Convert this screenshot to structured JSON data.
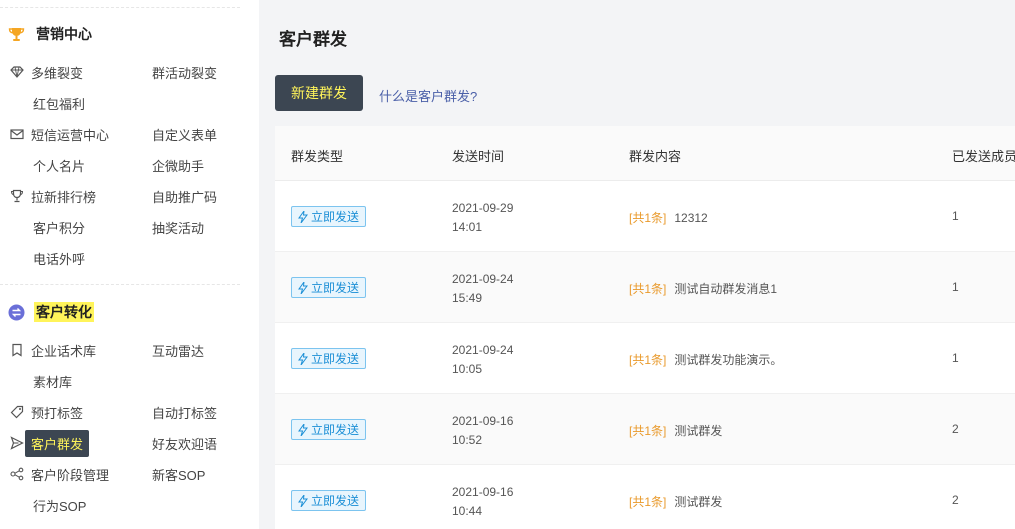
{
  "sidebar": {
    "marketing": {
      "title": "营销中心",
      "items": [
        {
          "label": "多维裂变",
          "icon": "diamond-icon"
        },
        {
          "label": "群活动裂变"
        },
        {
          "label": "红包福利"
        },
        {
          "label": "短信运营中心",
          "icon": "mail-icon"
        },
        {
          "label": "自定义表单"
        },
        {
          "label": "个人名片"
        },
        {
          "label": "企微助手"
        },
        {
          "label": "拉新排行榜",
          "icon": "trophy-icon"
        },
        {
          "label": "自助推广码"
        },
        {
          "label": "客户积分"
        },
        {
          "label": "抽奖活动"
        },
        {
          "label": "电话外呼"
        }
      ]
    },
    "conversion": {
      "title": "客户转化",
      "items": [
        {
          "label": "企业话术库",
          "icon": "bookmark-icon"
        },
        {
          "label": "互动雷达"
        },
        {
          "label": "素材库"
        },
        {
          "label": "预打标签",
          "icon": "tag-icon"
        },
        {
          "label": "自动打标签"
        },
        {
          "label": "客户群发",
          "icon": "send-icon",
          "active": true
        },
        {
          "label": "好友欢迎语"
        },
        {
          "label": "客户阶段管理",
          "icon": "flow-icon"
        },
        {
          "label": "新客SOP"
        },
        {
          "label": "行为SOP"
        }
      ]
    }
  },
  "main": {
    "title": "客户群发",
    "new_button": "新建群发",
    "help_link": "什么是客户群发?",
    "table": {
      "columns": [
        "群发类型",
        "发送时间",
        "群发内容",
        "已发送成员"
      ],
      "rows": [
        {
          "type": "立即发送",
          "date": "2021-09-29",
          "time": "14:01",
          "count": "[共1条]",
          "content": "12312",
          "sent": "1"
        },
        {
          "type": "立即发送",
          "date": "2021-09-24",
          "time": "15:49",
          "count": "[共1条]",
          "content": "测试自动群发消息1",
          "sent": "1"
        },
        {
          "type": "立即发送",
          "date": "2021-09-24",
          "time": "10:05",
          "count": "[共1条]",
          "content": "测试群发功能演示。",
          "sent": "1"
        },
        {
          "type": "立即发送",
          "date": "2021-09-16",
          "time": "10:52",
          "count": "[共1条]",
          "content": "测试群发",
          "sent": "2"
        },
        {
          "type": "立即发送",
          "date": "2021-09-16",
          "time": "10:44",
          "count": "[共1条]",
          "content": "测试群发",
          "sent": "2"
        }
      ]
    }
  },
  "colors": {
    "accent_dark": "#3c4652",
    "accent_yellow": "#fff45a",
    "tag_blue": "#1c8fd6",
    "count_orange": "#e99a2c",
    "link_blue": "#4a5fa8"
  }
}
